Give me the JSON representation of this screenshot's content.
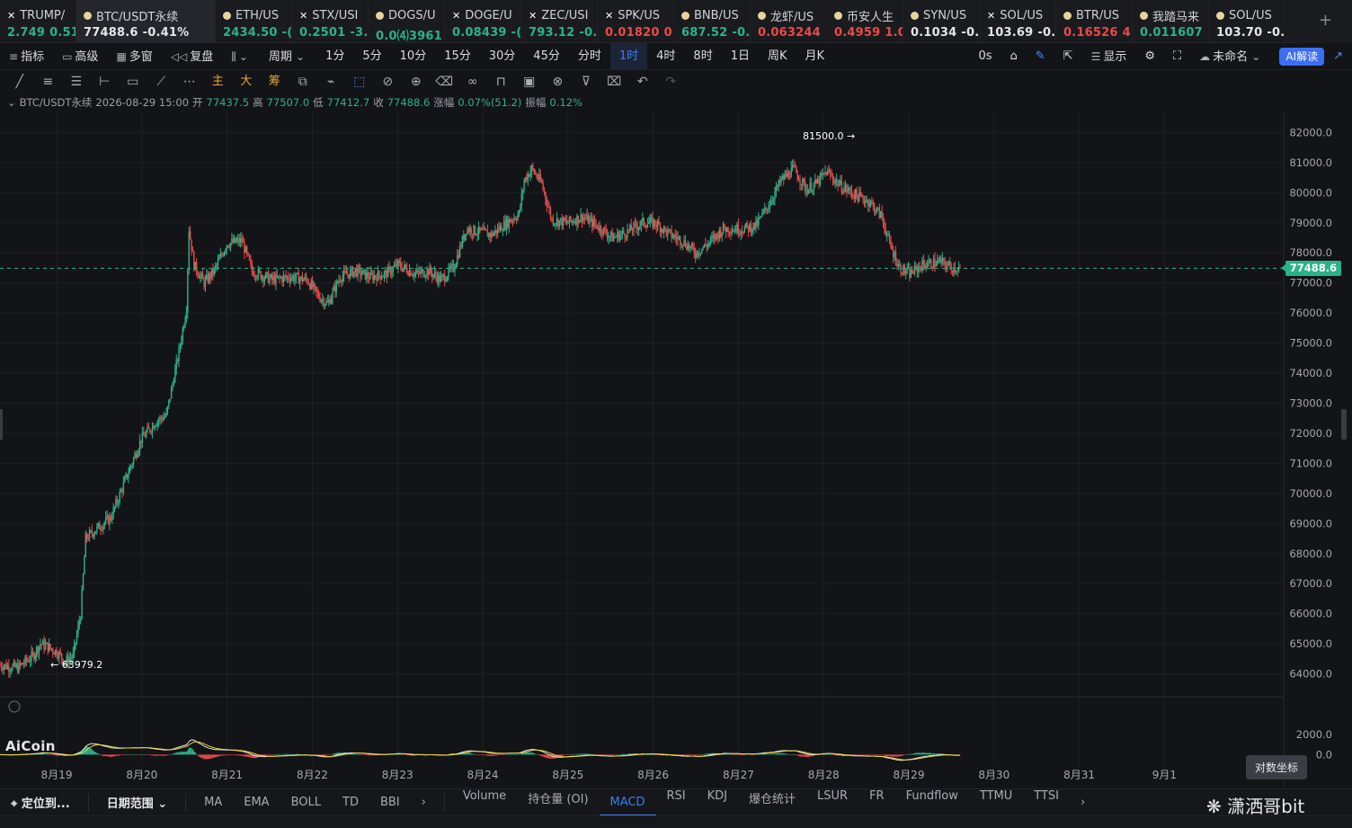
{
  "tickers": [
    {
      "name": "TRUMP/",
      "price": "2.749",
      "change": "0.51",
      "dir": "up",
      "icon": "close-icon",
      "active": false
    },
    {
      "name": "BTC/USDT永续",
      "price": "77488.6",
      "change": "-0.41%",
      "dir": "white",
      "icon": "coin-icon",
      "active": true
    },
    {
      "name": "ETH/US",
      "price": "2434.50",
      "change": "-(",
      "dir": "up",
      "icon": "coin-icon",
      "active": false
    },
    {
      "name": "STX/USI",
      "price": "0.2501",
      "change": "-3.",
      "dir": "up",
      "icon": "close-icon",
      "active": false
    },
    {
      "name": "DOGS/U",
      "price": "0.0⑷3961",
      "change": "",
      "dir": "up",
      "icon": "coin-icon",
      "active": false
    },
    {
      "name": "DOGE/U",
      "price": "0.08439",
      "change": "-(",
      "dir": "up",
      "icon": "close-icon",
      "active": false
    },
    {
      "name": "ZEC/USI",
      "price": "793.12",
      "change": "-0.",
      "dir": "up",
      "icon": "close-icon",
      "active": false
    },
    {
      "name": "SPK/US",
      "price": "0.01820",
      "change": "0.",
      "dir": "down",
      "icon": "close-icon",
      "active": false
    },
    {
      "name": "BNB/US",
      "price": "687.52",
      "change": "-0.",
      "dir": "up",
      "icon": "coin-icon",
      "active": false
    },
    {
      "name": "龙虾/US",
      "price": "0.063244",
      "change": "",
      "dir": "down",
      "icon": "coin-icon",
      "active": false
    },
    {
      "name": "币安人生",
      "price": "0.4959",
      "change": "1.0",
      "dir": "down",
      "icon": "coin-icon",
      "active": false
    },
    {
      "name": "SYN/US",
      "price": "0.1034",
      "change": "-0.",
      "dir": "white",
      "icon": "coin-icon",
      "active": false
    },
    {
      "name": "SOL/US",
      "price": "103.69",
      "change": "-0.",
      "dir": "white",
      "icon": "close-icon",
      "active": false
    },
    {
      "name": "BTR/US",
      "price": "0.16526",
      "change": "4.",
      "dir": "down",
      "icon": "coin-icon",
      "active": false
    },
    {
      "name": "我踏马来",
      "price": "0.011607",
      "change": "",
      "dir": "up",
      "icon": "coin-icon",
      "active": false
    },
    {
      "name": "SOL/US",
      "price": "103.70",
      "change": "-0.",
      "dir": "white",
      "icon": "coin-icon",
      "active": false
    }
  ],
  "toolbar": {
    "indicators": "指标",
    "advanced": "高级",
    "multi": "多窗",
    "replay": "复盘",
    "period": "周期",
    "periods": [
      "1分",
      "5分",
      "10分",
      "15分",
      "30分",
      "45分",
      "分时",
      "1时",
      "4时",
      "8时",
      "1日",
      "周K",
      "月K"
    ],
    "active_period": "1时",
    "countdown": "0s",
    "display": "显示",
    "layout_name": "未命名",
    "ai_button": "AI解读"
  },
  "drawtools": {
    "main": "主",
    "big": "大",
    "ex": "筹"
  },
  "info": {
    "symbol": "BTC/USDT永续",
    "datetime": "2026-08-29 15:00",
    "open_label": "开",
    "open": "77437.5",
    "high_label": "高",
    "high": "77507.0",
    "low_label": "低",
    "low": "77412.7",
    "close_label": "收",
    "close": "77488.6",
    "chg_label": "涨幅",
    "chg": "0.07%(51.2)",
    "amp_label": "振幅",
    "amp": "0.12%"
  },
  "chart_data": {
    "type": "candlestick",
    "title": "BTC/USDT永续",
    "x": [
      "8月19",
      "8月20",
      "8月21",
      "8月22",
      "8月23",
      "8月24",
      "8月25",
      "8月26",
      "8月27",
      "8月28",
      "8月29",
      "8月30",
      "8月31",
      "9月1"
    ],
    "ylim": [
      63300,
      82700
    ],
    "yticks": [
      64000,
      65000,
      66000,
      67000,
      68000,
      69000,
      70000,
      71000,
      72000,
      73000,
      74000,
      75000,
      76000,
      77000,
      78000,
      79000,
      80000,
      81000,
      82000
    ],
    "current_price": 77488.6,
    "max_label": "81500.0",
    "min_label": "63979.2",
    "close_path": [
      [
        0,
        64300
      ],
      [
        14,
        64200
      ],
      [
        26,
        64600
      ],
      [
        32,
        65000
      ],
      [
        38,
        64900
      ],
      [
        46,
        64700
      ],
      [
        52,
        64400
      ],
      [
        58,
        64600
      ],
      [
        64,
        66000
      ],
      [
        68,
        68500
      ],
      [
        76,
        68800
      ],
      [
        88,
        69200
      ],
      [
        100,
        70500
      ],
      [
        112,
        71800
      ],
      [
        124,
        72400
      ],
      [
        132,
        72600
      ],
      [
        142,
        74700
      ],
      [
        148,
        76200
      ],
      [
        150,
        78800
      ],
      [
        154,
        77600
      ],
      [
        162,
        77000
      ],
      [
        170,
        77400
      ],
      [
        180,
        78300
      ],
      [
        192,
        78400
      ],
      [
        200,
        77400
      ],
      [
        216,
        77100
      ],
      [
        230,
        77200
      ],
      [
        244,
        77100
      ],
      [
        252,
        76600
      ],
      [
        260,
        76300
      ],
      [
        270,
        77200
      ],
      [
        282,
        77400
      ],
      [
        294,
        77200
      ],
      [
        306,
        77300
      ],
      [
        316,
        77600
      ],
      [
        330,
        77300
      ],
      [
        340,
        77400
      ],
      [
        350,
        77100
      ],
      [
        360,
        77500
      ],
      [
        370,
        78800
      ],
      [
        380,
        78700
      ],
      [
        390,
        78600
      ],
      [
        402,
        79000
      ],
      [
        412,
        79300
      ],
      [
        416,
        80400
      ],
      [
        422,
        80800
      ],
      [
        430,
        80300
      ],
      [
        438,
        79100
      ],
      [
        450,
        79000
      ],
      [
        462,
        79200
      ],
      [
        474,
        78900
      ],
      [
        486,
        78500
      ],
      [
        498,
        78700
      ],
      [
        510,
        79000
      ],
      [
        520,
        79000
      ],
      [
        532,
        78600
      ],
      [
        542,
        78400
      ],
      [
        552,
        78000
      ],
      [
        562,
        78300
      ],
      [
        574,
        78800
      ],
      [
        590,
        78800
      ],
      [
        600,
        78900
      ],
      [
        610,
        79600
      ],
      [
        620,
        80400
      ],
      [
        630,
        80800
      ],
      [
        640,
        80100
      ],
      [
        648,
        80300
      ],
      [
        656,
        80700
      ],
      [
        668,
        80200
      ],
      [
        680,
        79900
      ],
      [
        690,
        79700
      ],
      [
        700,
        79200
      ],
      [
        706,
        78300
      ],
      [
        714,
        77500
      ],
      [
        722,
        77300
      ],
      [
        732,
        77600
      ],
      [
        746,
        77700
      ],
      [
        756,
        77500
      ],
      [
        762,
        77500
      ]
    ],
    "macd_ylim": [
      -500,
      3500
    ],
    "macd_yticks": [
      0,
      2000
    ]
  },
  "overlays": {
    "watermark": "潇洒哥bit",
    "logo": "AiCoin",
    "tooltip": "对数坐标",
    "macd_note": "2000.0"
  },
  "bottombar": {
    "locate": "定位到...",
    "range": "日期范围",
    "main_indicators": [
      "MA",
      "EMA",
      "BOLL",
      "TD",
      "BBI"
    ],
    "sub_indicators": [
      "Volume",
      "持仓量 (OI)",
      "MACD",
      "RSI",
      "KDJ",
      "爆仓统计",
      "LSUR",
      "FR",
      "Fundflow",
      "TTMU",
      "TTSI"
    ],
    "active_sub": "MACD"
  }
}
